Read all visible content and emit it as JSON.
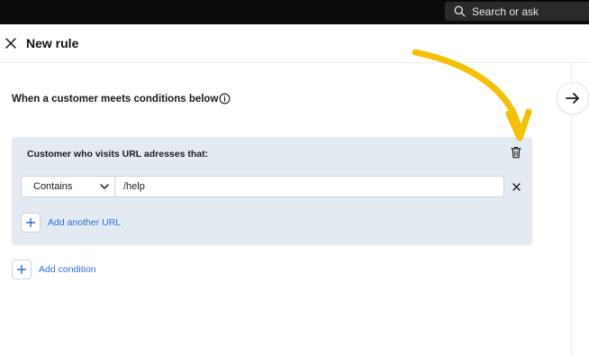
{
  "topbar": {
    "search_label": "Search or ask",
    "search_icon": "search-icon"
  },
  "header": {
    "title": "New rule",
    "close_icon": "close-icon"
  },
  "rule": {
    "heading": "When a customer meets conditions below",
    "info_icon": "info-icon",
    "next_icon": "arrow-right-icon"
  },
  "condition_card": {
    "title": "Customer who visits URL adresses that:",
    "delete_icon": "trash-icon",
    "operator": {
      "selected": "Contains"
    },
    "url_value": "/help",
    "add_url_label": "Add another URL"
  },
  "add_condition_label": "Add condition",
  "colors": {
    "topbar": "#0b0b0b",
    "card_background": "#e4eaf2",
    "link_blue": "#2f6fd9",
    "annotation_arrow": "#f5c000"
  }
}
